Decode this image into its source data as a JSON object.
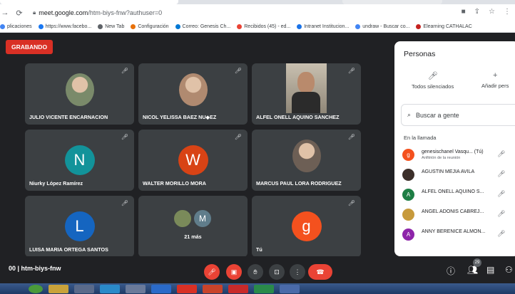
{
  "browser": {
    "url_host": "meet.google.com",
    "url_path": "/htm-biys-fnw?authuser=0",
    "bookmarks": [
      {
        "label": "plicaciones",
        "icon": "apps-icon",
        "color": "#4285f4"
      },
      {
        "label": "https://www.facebo...",
        "icon": "facebook-icon",
        "color": "#1877f2"
      },
      {
        "label": "New Tab",
        "icon": "globe-icon",
        "color": "#5f6368"
      },
      {
        "label": "Configuración",
        "icon": "gear-icon",
        "color": "#e8710a"
      },
      {
        "label": "Correo: Genesis Ch...",
        "icon": "outlook-icon",
        "color": "#0078d4"
      },
      {
        "label": "Recibidos (45) - ed...",
        "icon": "gmail-icon",
        "color": "#ea4335"
      },
      {
        "label": "Intranet Institucion...",
        "icon": "intranet-icon",
        "color": "#1a73e8"
      },
      {
        "label": "undraw - Buscar co...",
        "icon": "google-icon",
        "color": "#4285f4"
      },
      {
        "label": "Elearning CATHALAC",
        "icon": "elearning-icon",
        "color": "#c5221f"
      }
    ]
  },
  "meet": {
    "recording_label": "GRABANDO",
    "meeting_code": "00 | htm-biys-fnw",
    "tiles": [
      {
        "name": "JULIO VICENTE ENCARNACION",
        "type": "photo",
        "color": "#7a8a6a"
      },
      {
        "name": "NICOL YELISSA BAEZ NU◆EZ",
        "type": "photo",
        "color": "#b08a70"
      },
      {
        "name": "ALFEL ONELL AQUINO SANCHEZ",
        "type": "video",
        "color": "#8f8778"
      },
      {
        "name": "Niurky López Ramírez",
        "type": "initial",
        "initial": "N",
        "color": "#12939a"
      },
      {
        "name": "WALTER MORILLO MORA",
        "type": "initial",
        "initial": "W",
        "color": "#d84315"
      },
      {
        "name": "MARCUS PAUL LORA RODRIGUEZ",
        "type": "photo",
        "color": "#6d5f55"
      },
      {
        "name": "LUISA MARIA ORTEGA SANTOS",
        "type": "initial",
        "initial": "L",
        "color": "#1565c0"
      },
      {
        "name": "21 más",
        "type": "group",
        "initial": "M",
        "color": "#607d8b"
      },
      {
        "name": "Tú",
        "type": "initial",
        "initial": "g",
        "color": "#f4511e"
      }
    ]
  },
  "panel": {
    "title": "Personas",
    "mute_all": "Todos silenciados",
    "add_people": "Añadir pers",
    "search_placeholder": "Buscar a gente",
    "section": "En la llamada",
    "people": [
      {
        "name": "genesischanel Vasqu... (Tú)",
        "sub": "Anfitrión de la reunión",
        "initial": "g",
        "color": "#f4511e"
      },
      {
        "name": "AGUSTIN MEJIA AVILA",
        "sub": "",
        "initial": "",
        "color": "#3c2f2a"
      },
      {
        "name": "ALFEL ONELL AQUINO S...",
        "sub": "",
        "initial": "A",
        "color": "#1e7e45"
      },
      {
        "name": "ANGEL ADONIS CABREJ...",
        "sub": "",
        "initial": "",
        "color": "#c79a3c"
      },
      {
        "name": "ANNY BERENICE ALMON...",
        "sub": "",
        "initial": "A",
        "color": "#8e24aa"
      }
    ]
  },
  "controls": {
    "participants_count": "29"
  }
}
